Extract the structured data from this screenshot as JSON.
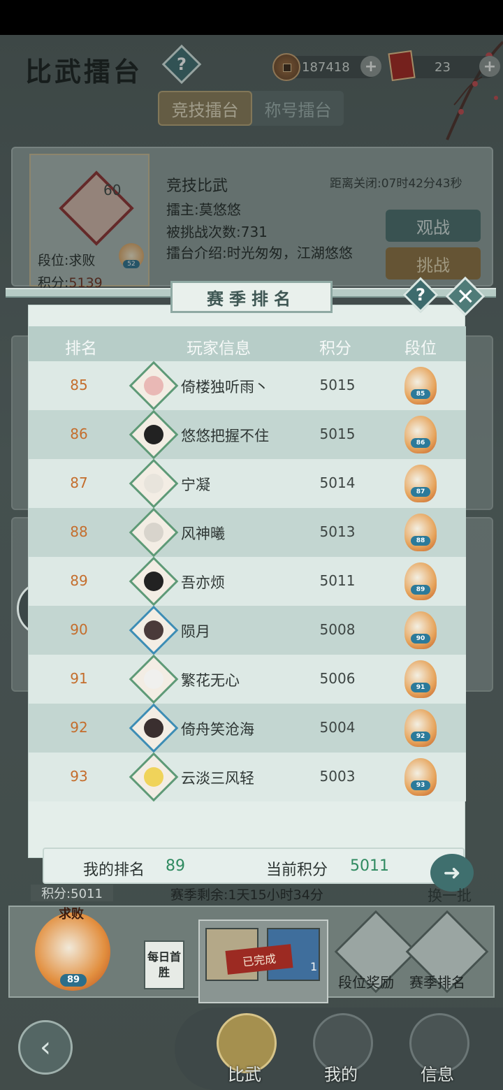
{
  "header": {
    "title": "比武擂台",
    "help": "?",
    "coins": "187418",
    "tickets": "23",
    "plus": "+"
  },
  "tabs": [
    {
      "label": "竞技擂台",
      "active": true
    },
    {
      "label": "称号擂台",
      "active": false
    }
  ],
  "arena": {
    "level": "60",
    "rank_label": "段位:求败",
    "score_label": "积分:",
    "score_value": "5139",
    "badge_level": "52",
    "name": "竞技比武",
    "countdown": "距离关闭:07时42分43秒",
    "host": "擂主:莫悠悠",
    "challenged": "被挑战次数:731",
    "intro": "擂台介绍:时光匆匆，江湖悠悠",
    "watch_button": "观战",
    "challenge_button": "挑战"
  },
  "modal": {
    "title": "赛季排名",
    "help": "?",
    "close": "✕",
    "columns": [
      "排名",
      "玩家信息",
      "积分",
      "段位"
    ],
    "rows": [
      {
        "rank": "85",
        "name": "倚楼独听雨丶",
        "score": "5015",
        "badge": "85",
        "avatar_color": "#e9b8b5"
      },
      {
        "rank": "86",
        "name": "悠悠把握不住",
        "score": "5015",
        "badge": "86",
        "avatar_color": "#222222"
      },
      {
        "rank": "87",
        "name": "宁凝",
        "score": "5014",
        "badge": "87",
        "avatar_color": "#e8e4dc"
      },
      {
        "rank": "88",
        "name": "风神曦",
        "score": "5013",
        "badge": "88",
        "avatar_color": "#d8d4cc"
      },
      {
        "rank": "89",
        "name": "吾亦烦",
        "score": "5011",
        "badge": "89",
        "avatar_color": "#222222"
      },
      {
        "rank": "90",
        "name": "陨月",
        "score": "5008",
        "badge": "90",
        "avatar_color": "#4a3a3a"
      },
      {
        "rank": "91",
        "name": "繁花无心",
        "score": "5006",
        "badge": "91",
        "avatar_color": "#f0f0ee"
      },
      {
        "rank": "92",
        "name": "倚舟笑沧海",
        "score": "5004",
        "badge": "92",
        "avatar_color": "#3a2f2f"
      },
      {
        "rank": "93",
        "name": "云淡三风轻",
        "score": "5003",
        "badge": "93",
        "avatar_color": "#f0d35a"
      }
    ],
    "my_rank_label": "我的排名",
    "my_rank_value": "89",
    "current_score_label": "当前积分",
    "current_score_value": "5011"
  },
  "footer": {
    "score": "积分:5011",
    "season_remaining": "赛季剩余:1天15小时34分",
    "refresh": "换一批",
    "rank_emblem_label": "求败",
    "rank_emblem_level": "89",
    "daily_first_win": "每日首胜",
    "completed": "已完成",
    "reward_qty": "1",
    "tier_reward": "段位奖励",
    "season_ranking": "赛季排名"
  },
  "nav": {
    "back": "‹",
    "items": [
      "比武",
      "我的",
      "信息"
    ]
  }
}
